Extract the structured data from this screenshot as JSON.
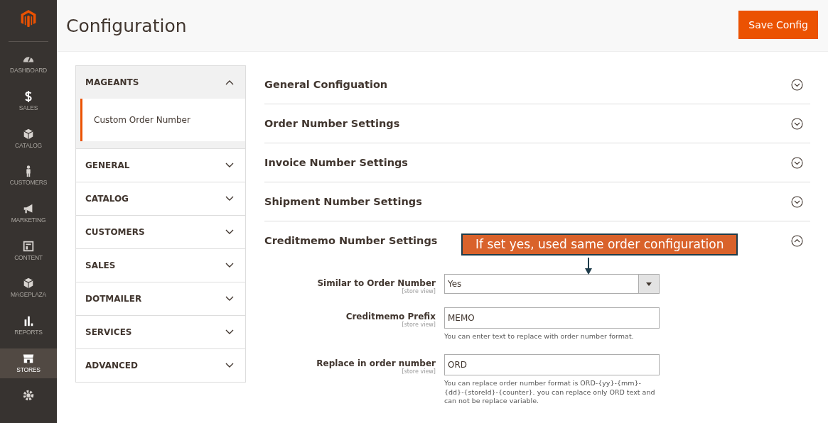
{
  "nav": [
    {
      "label": "DASHBOARD",
      "selected": false
    },
    {
      "label": "SALES",
      "selected": false
    },
    {
      "label": "CATALOG",
      "selected": false
    },
    {
      "label": "CUSTOMERS",
      "selected": false
    },
    {
      "label": "MARKETING",
      "selected": false
    },
    {
      "label": "CONTENT",
      "selected": false
    },
    {
      "label": "MAGEPLAZA",
      "selected": false
    },
    {
      "label": "REPORTS",
      "selected": false
    },
    {
      "label": "STORES",
      "selected": true
    },
    {
      "selected": false
    }
  ],
  "page_title": "Configuration",
  "save_button": "Save Config",
  "groups": [
    {
      "label": "MAGEANTS",
      "expanded": true,
      "children": [
        {
          "label": "Custom Order Number",
          "selected": true
        }
      ]
    },
    {
      "label": "GENERAL",
      "expanded": false
    },
    {
      "label": "CATALOG",
      "expanded": false
    },
    {
      "label": "CUSTOMERS",
      "expanded": false
    },
    {
      "label": "SALES",
      "expanded": false
    },
    {
      "label": "DOTMAILER",
      "expanded": false
    },
    {
      "label": "SERVICES",
      "expanded": false
    },
    {
      "label": "ADVANCED",
      "expanded": false
    }
  ],
  "sections": [
    {
      "title": "General Configuation",
      "expanded": false
    },
    {
      "title": "Order Number Settings",
      "expanded": false
    },
    {
      "title": "Invoice Number Settings",
      "expanded": false
    },
    {
      "title": "Shipment Number Settings",
      "expanded": false
    },
    {
      "title": "Creditmemo Number Settings",
      "expanded": true
    }
  ],
  "callout": "If set yes, used same order configuration",
  "fields": [
    {
      "kind": "select",
      "label": "Similar to Order Number",
      "scope": "[store view]",
      "value": "Yes"
    },
    {
      "kind": "text",
      "label": "Creditmemo Prefix",
      "scope": "[store view]",
      "value": "MEMO",
      "note": "You can enter text to replace with order number format."
    },
    {
      "kind": "text",
      "label": "Replace in order number",
      "scope": "[store view]",
      "value": "ORD",
      "note": "You can replace order number format is ORD-{yy}-{mm}-{dd}-{storeId}-{counter}. you can replace only ORD text and can not be replace variable."
    }
  ]
}
